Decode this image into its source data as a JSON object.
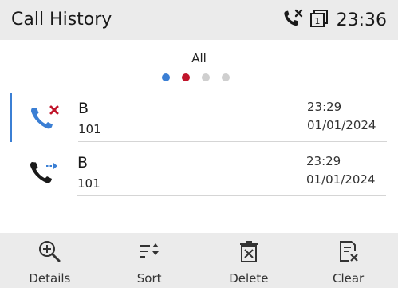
{
  "header": {
    "title": "Call History",
    "time": "23:36",
    "icons": [
      "missed-call-status-icon",
      "page-counter-icon"
    ],
    "page_counter": "1"
  },
  "filter": {
    "label": "All",
    "dots": [
      "#3b7fd4",
      "#c0152b",
      "#cfcfcf",
      "#cfcfcf"
    ],
    "active_index": 0
  },
  "calls": [
    {
      "name": "B",
      "number": "101",
      "time": "23:29",
      "date": "01/01/2024",
      "type": "missed",
      "icon": "missed-call-icon",
      "selected": true
    },
    {
      "name": "B",
      "number": "101",
      "time": "23:29",
      "date": "01/01/2024",
      "type": "forwarded",
      "icon": "forwarded-call-icon",
      "selected": false
    }
  ],
  "toolbar": {
    "details_label": "Details",
    "sort_label": "Sort",
    "delete_label": "Delete",
    "clear_label": "Clear"
  },
  "colors": {
    "accent": "#3b7fd4",
    "missed": "#c0152b",
    "bar_background": "#ebebeb"
  }
}
